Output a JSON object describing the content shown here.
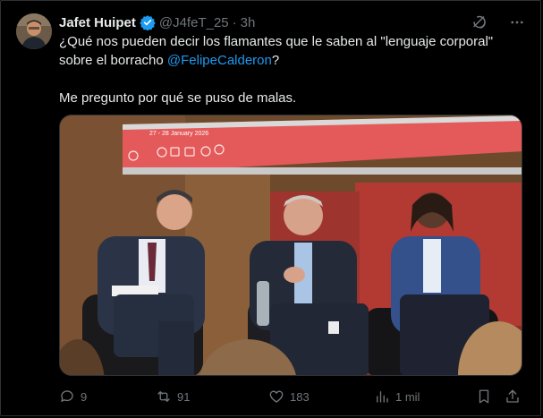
{
  "tweet": {
    "display_name": "Jafet Huipet",
    "handle": "@J4feT_25",
    "separator": "·",
    "time": "3h",
    "text_line1_a": "¿Qué nos pueden decir los flamantes que le saben al \"lenguaje corporal\" sobre el borracho ",
    "mention": "@FelipeCalderon",
    "text_line1_b": "?",
    "text_line2": "Me pregunto por qué se puso de malas.",
    "media_screen_text": "27 - 28 January 2026"
  },
  "actions": {
    "replies": "9",
    "reposts": "91",
    "likes": "183",
    "views": "1 mil"
  },
  "icons": {
    "verified": "verified-badge-icon",
    "grok": "grok-icon",
    "more": "more-icon",
    "reply": "reply-icon",
    "repost": "repost-icon",
    "like": "like-icon",
    "views": "views-icon",
    "bookmark": "bookmark-icon",
    "share": "share-icon"
  },
  "colors": {
    "background": "#000000",
    "text": "#e7e9ea",
    "muted": "#71767b",
    "accent": "#1d9bf0"
  }
}
